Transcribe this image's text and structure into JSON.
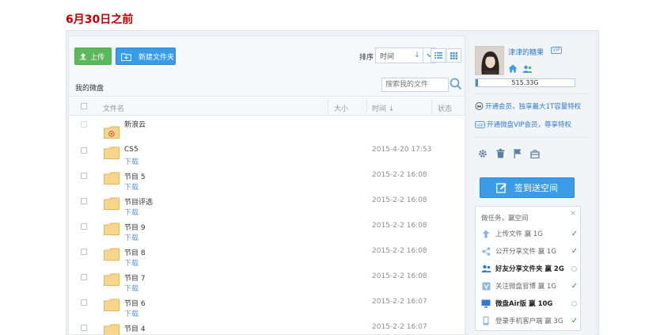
{
  "caption": "6月30日之前",
  "toolbar": {
    "upload_label": "上传",
    "new_folder_label": "新建文件夹",
    "sort_label": "排序",
    "sort_value": "时间",
    "sort_arrow": "↓"
  },
  "breadcrumb": "我的微盘",
  "search": {
    "placeholder": "搜索我的文件"
  },
  "table": {
    "headers": {
      "name": "文件名",
      "size": "大小",
      "time": "时间",
      "status": "状态"
    },
    "time_sort_arrow": "↓",
    "rows": [
      {
        "name": "新浪云",
        "download": "",
        "time": ""
      },
      {
        "name": "CS5",
        "download": "下载",
        "time": "2015-4-20 17:53"
      },
      {
        "name": "节目 5",
        "download": "下载",
        "time": "2015-2-2 16:08"
      },
      {
        "name": "节目评选",
        "download": "下载",
        "time": "2015-2-2 16:08"
      },
      {
        "name": "节目 9",
        "download": "下载",
        "time": "2015-2-2 16:08"
      },
      {
        "name": "节目 8",
        "download": "下载",
        "time": "2015-2-2 16:08"
      },
      {
        "name": "节目 7",
        "download": "下载",
        "time": "2015-2-2 16:08"
      },
      {
        "name": "节目 6",
        "download": "下载",
        "time": "2015-2-2 16:07"
      },
      {
        "name": "节目 4",
        "download": "",
        "time": "2015-2-2 16:07"
      }
    ]
  },
  "profile": {
    "username": "津津的糖果",
    "vip_badge": "VIP",
    "quota_text": "515.33G",
    "quota_fraction": 0.02
  },
  "promos": {
    "member": "开通会员，独享最大1T容量特权",
    "vip": "开通微盘VIP会员，尊享特权"
  },
  "checkin_label": "签到送空间",
  "tasks": {
    "title": "做任务，赢空间",
    "close": "×",
    "items": [
      {
        "label": "上传文件 赢 1G",
        "done": true,
        "bold": false,
        "icon": "upload-icon"
      },
      {
        "label": "公开分享文件 赢 1G",
        "done": true,
        "bold": false,
        "icon": "share-icon"
      },
      {
        "label": "好友分享文件夹 赢 2G",
        "done": false,
        "bold": true,
        "icon": "people-icon"
      },
      {
        "label": "关注微盘官博 赢 1G",
        "done": true,
        "bold": false,
        "icon": "vdisk-icon"
      },
      {
        "label": "微盘Air版 赢 10G",
        "done": false,
        "bold": true,
        "icon": "monitor-icon"
      },
      {
        "label": "登录手机客户端 赢 3G",
        "done": true,
        "bold": false,
        "icon": "phone-icon"
      }
    ]
  },
  "colors": {
    "caption": "#c00000",
    "upload_button": "#5cb85c",
    "primary_button": "#3a9be9",
    "link": "#2f7bd2",
    "check": "#2e9a3a"
  }
}
